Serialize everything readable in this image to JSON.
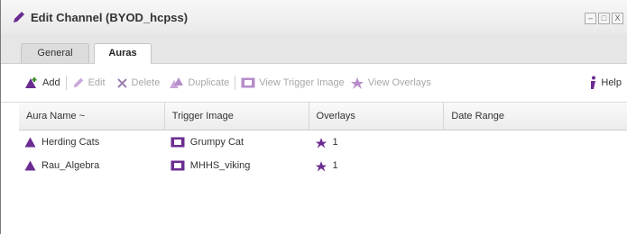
{
  "window": {
    "title": "Edit Channel (BYOD_hcpss)",
    "controls": [
      "–",
      "□",
      "X"
    ]
  },
  "tabs": [
    {
      "label": "General",
      "active": false
    },
    {
      "label": "Auras",
      "active": true
    }
  ],
  "toolbar": {
    "add": "Add",
    "edit": "Edit",
    "delete": "Delete",
    "duplicate": "Duplicate",
    "view_trigger_image": "View Trigger Image",
    "view_overlays": "View Overlays",
    "help": "Help"
  },
  "grid": {
    "columns": [
      "Aura Name ~",
      "Trigger Image",
      "Overlays",
      "Date Range"
    ],
    "rows": [
      {
        "name": "Herding Cats",
        "trigger": "Grumpy Cat",
        "overlays": "1",
        "date": ""
      },
      {
        "name": "Rau_Algebra",
        "trigger": "MHHS_viking",
        "overlays": "1",
        "date": ""
      }
    ]
  },
  "colors": {
    "accent": "#6b2c91",
    "disabled": "#a7a7a7"
  }
}
